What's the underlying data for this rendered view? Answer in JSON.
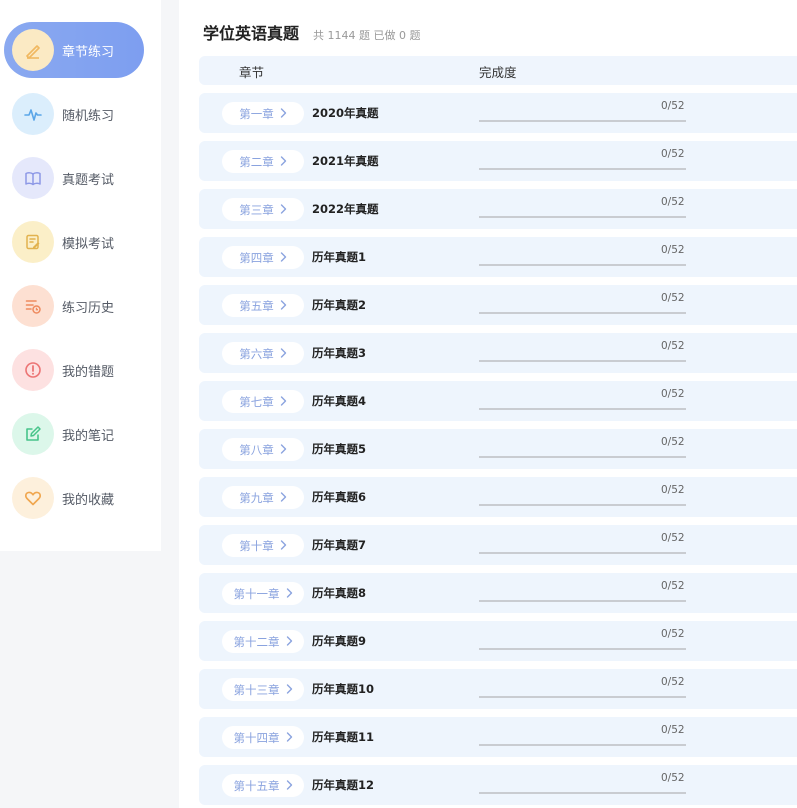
{
  "sidebar": {
    "items": [
      {
        "label": "章节练习",
        "icon": "pencil-icon",
        "icon_bg": "#fbeac4",
        "icon_color": "#f0b860",
        "active": true
      },
      {
        "label": "随机练习",
        "icon": "pulse-icon",
        "icon_bg": "#dbeefc",
        "icon_color": "#5aa6e8",
        "active": false
      },
      {
        "label": "真题考试",
        "icon": "book-icon",
        "icon_bg": "#e5e8fb",
        "icon_color": "#8d98e6",
        "active": false
      },
      {
        "label": "模拟考试",
        "icon": "edit-doc-icon",
        "icon_bg": "#fbefc8",
        "icon_color": "#e2b24e",
        "active": false
      },
      {
        "label": "练习历史",
        "icon": "history-icon",
        "icon_bg": "#fde0d2",
        "icon_color": "#ee8a5e",
        "active": false
      },
      {
        "label": "我的错题",
        "icon": "alert-icon",
        "icon_bg": "#fde1e1",
        "icon_color": "#ec7474",
        "active": false
      },
      {
        "label": "我的笔记",
        "icon": "note-icon",
        "icon_bg": "#dcf7ea",
        "icon_color": "#46c48a",
        "active": false
      },
      {
        "label": "我的收藏",
        "icon": "heart-icon",
        "icon_bg": "#fdf0dc",
        "icon_color": "#f0a64e",
        "active": false
      }
    ]
  },
  "header": {
    "title": "学位英语真题",
    "stats": "共 1144 题 已做 0 题"
  },
  "table": {
    "col_chapter": "章节",
    "col_progress": "完成度"
  },
  "chapters": [
    {
      "chapter": "第一章",
      "name": "2020年真题",
      "progress": "0/52",
      "done": 0,
      "total": 52
    },
    {
      "chapter": "第二章",
      "name": "2021年真题",
      "progress": "0/52",
      "done": 0,
      "total": 52
    },
    {
      "chapter": "第三章",
      "name": "2022年真题",
      "progress": "0/52",
      "done": 0,
      "total": 52
    },
    {
      "chapter": "第四章",
      "name": "历年真题1",
      "progress": "0/52",
      "done": 0,
      "total": 52
    },
    {
      "chapter": "第五章",
      "name": "历年真题2",
      "progress": "0/52",
      "done": 0,
      "total": 52
    },
    {
      "chapter": "第六章",
      "name": "历年真题3",
      "progress": "0/52",
      "done": 0,
      "total": 52
    },
    {
      "chapter": "第七章",
      "name": "历年真题4",
      "progress": "0/52",
      "done": 0,
      "total": 52
    },
    {
      "chapter": "第八章",
      "name": "历年真题5",
      "progress": "0/52",
      "done": 0,
      "total": 52
    },
    {
      "chapter": "第九章",
      "name": "历年真题6",
      "progress": "0/52",
      "done": 0,
      "total": 52
    },
    {
      "chapter": "第十章",
      "name": "历年真题7",
      "progress": "0/52",
      "done": 0,
      "total": 52
    },
    {
      "chapter": "第十一章",
      "name": "历年真题8",
      "progress": "0/52",
      "done": 0,
      "total": 52
    },
    {
      "chapter": "第十二章",
      "name": "历年真题9",
      "progress": "0/52",
      "done": 0,
      "total": 52
    },
    {
      "chapter": "第十三章",
      "name": "历年真题10",
      "progress": "0/52",
      "done": 0,
      "total": 52
    },
    {
      "chapter": "第十四章",
      "name": "历年真题11",
      "progress": "0/52",
      "done": 0,
      "total": 52
    },
    {
      "chapter": "第十五章",
      "name": "历年真题12",
      "progress": "0/52",
      "done": 0,
      "total": 52
    }
  ]
}
